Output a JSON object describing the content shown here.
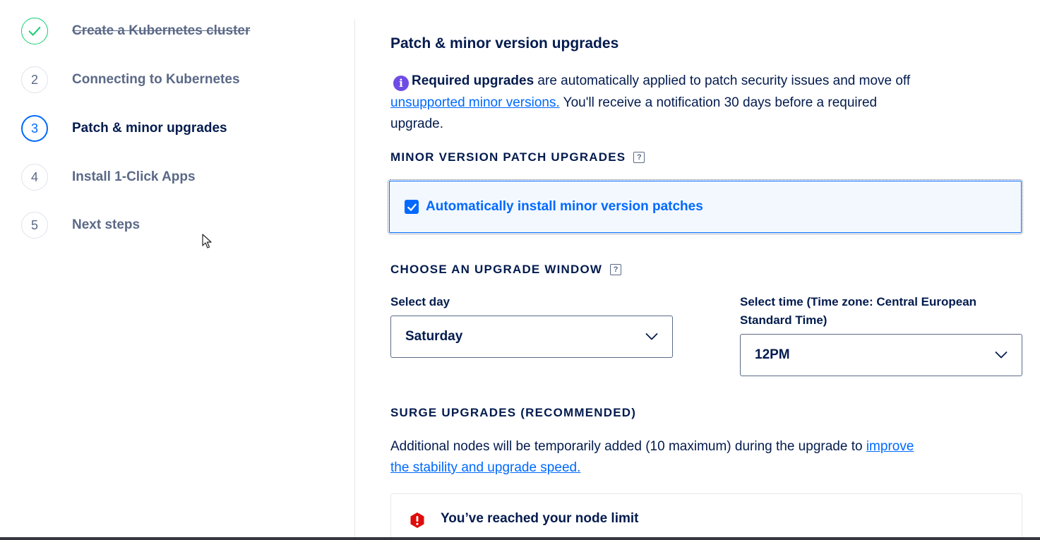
{
  "steps": [
    {
      "number": "",
      "label": "Create a Kubernetes cluster",
      "state": "done"
    },
    {
      "number": "2",
      "label": "Connecting to Kubernetes",
      "state": "todo"
    },
    {
      "number": "3",
      "label": "Patch & minor upgrades",
      "state": "active"
    },
    {
      "number": "4",
      "label": "Install 1-Click Apps",
      "state": "todo"
    },
    {
      "number": "5",
      "label": "Next steps",
      "state": "todo"
    }
  ],
  "main": {
    "title": "Patch & minor version upgrades",
    "info": {
      "bold": "Required upgrades",
      "text1": " are automatically applied to patch security issues and move off ",
      "link": "unsupported minor versions.",
      "text2": " You'll receive a notification 30 days before a required upgrade."
    },
    "patch_section": {
      "heading": "MINOR VERSION PATCH UPGRADES",
      "help": "?",
      "checkbox_label": "Automatically install minor version patches",
      "checked": true
    },
    "window_section": {
      "heading": "CHOOSE AN UPGRADE WINDOW",
      "help": "?",
      "day_label": "Select day",
      "day_value": "Saturday",
      "time_label": "Select time (Time zone: Central European Standard Time)",
      "time_value": "12PM"
    },
    "surge_section": {
      "heading": "SURGE UPGRADES (RECOMMENDED)",
      "text": "Additional nodes will be temporarily added (10 maximum) during the upgrade to ",
      "link": "improve the stability and upgrade speed."
    },
    "alert": {
      "title": "You’ve reached your node limit"
    }
  },
  "colors": {
    "accent": "#0069ff",
    "success": "#15cd72",
    "info_icon": "#6f4ce5",
    "error": "#e00b0b",
    "text": "#031b4e",
    "muted": "#5b6987"
  },
  "icons": {
    "done_step": "check-icon",
    "info": "info-icon",
    "help": "help-icon",
    "select": "chevron-down-icon",
    "alert": "error-octagon-icon",
    "pointer": "mouse-cursor-icon"
  }
}
